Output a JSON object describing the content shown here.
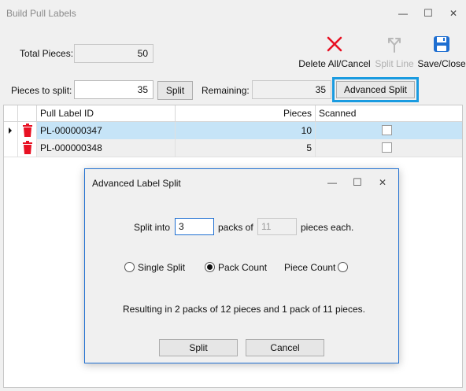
{
  "window": {
    "title": "Build Pull Labels",
    "controls": {
      "minimize": "—",
      "maximize": "☐",
      "close": "✕"
    }
  },
  "form": {
    "total_pieces_label": "Total Pieces:",
    "total_pieces_value": "50",
    "pieces_to_split_label": "Pieces to split:",
    "pieces_to_split_value": "35",
    "split_button": "Split",
    "remaining_label": "Remaining:",
    "remaining_value": "35",
    "advanced_split_button": "Advanced Split"
  },
  "toolbar": {
    "delete_all_label": "Delete All/Cancel",
    "delete_icon": "x-icon",
    "split_line_label": "Split Line",
    "split_line_icon": "split-icon",
    "save_close_label": "Save/Close",
    "save_icon": "floppy-icon"
  },
  "grid": {
    "columns": [
      "Pull Label ID",
      "Pieces",
      "Scanned"
    ],
    "rows": [
      {
        "id": "PL-000000347",
        "pieces": "10",
        "scanned": false,
        "selected": true
      },
      {
        "id": "PL-000000348",
        "pieces": "5",
        "scanned": false,
        "selected": false
      }
    ]
  },
  "dialog": {
    "title": "Advanced Label Split",
    "split_into_label": "Split into",
    "split_into_value": "3",
    "packs_of_label": "packs of",
    "packs_of_value": "11",
    "pieces_each_label": "pieces each.",
    "options": {
      "single_split": "Single Split",
      "pack_count": "Pack Count",
      "piece_count": "Piece Count",
      "selected": "pack_count"
    },
    "result_text": "Resulting in 2 packs of 12 pieces and 1 pack of 11 pieces.",
    "split_button": "Split",
    "cancel_button": "Cancel"
  },
  "colors": {
    "accent_blue": "#1a9be0",
    "selection": "#c6e4f7",
    "delete_red": "#e81123",
    "save_blue": "#1f6fd1"
  }
}
